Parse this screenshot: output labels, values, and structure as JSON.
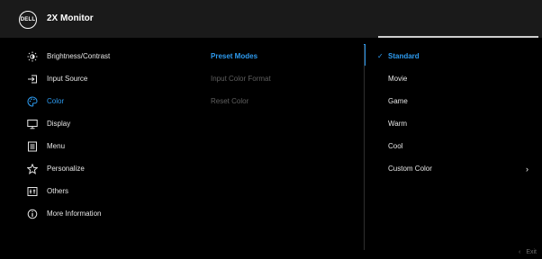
{
  "header": {
    "logo_text": "DELL",
    "title": "2X Monitor"
  },
  "left_menu": {
    "items": [
      {
        "label": "Brightness/Contrast",
        "icon": "brightness-icon",
        "active": false
      },
      {
        "label": "Input Source",
        "icon": "input-source-icon",
        "active": false
      },
      {
        "label": "Color",
        "icon": "palette-icon",
        "active": true
      },
      {
        "label": "Display",
        "icon": "display-icon",
        "active": false
      },
      {
        "label": "Menu",
        "icon": "menu-icon",
        "active": false
      },
      {
        "label": "Personalize",
        "icon": "star-icon",
        "active": false
      },
      {
        "label": "Others",
        "icon": "others-icon",
        "active": false
      },
      {
        "label": "More Information",
        "icon": "info-icon",
        "active": false
      }
    ]
  },
  "middle_menu": {
    "items": [
      {
        "label": "Preset Modes",
        "state": "selected"
      },
      {
        "label": "Input Color Format",
        "state": "dim"
      },
      {
        "label": "Reset Color",
        "state": "dim"
      }
    ]
  },
  "right_menu": {
    "items": [
      {
        "label": "Standard",
        "checked": true,
        "submenu": false
      },
      {
        "label": "Movie",
        "checked": false,
        "submenu": false
      },
      {
        "label": "Game",
        "checked": false,
        "submenu": false
      },
      {
        "label": "Warm",
        "checked": false,
        "submenu": false
      },
      {
        "label": "Cool",
        "checked": false,
        "submenu": false
      },
      {
        "label": "Custom Color",
        "checked": false,
        "submenu": true
      }
    ],
    "check_glyph": "✓",
    "submenu_glyph": "›"
  },
  "footer": {
    "exit_arrow": "‹",
    "exit_label": "Exit"
  },
  "colors": {
    "accent": "#2d9bf0",
    "header_bg": "#1a1a1a",
    "background": "#000000"
  }
}
